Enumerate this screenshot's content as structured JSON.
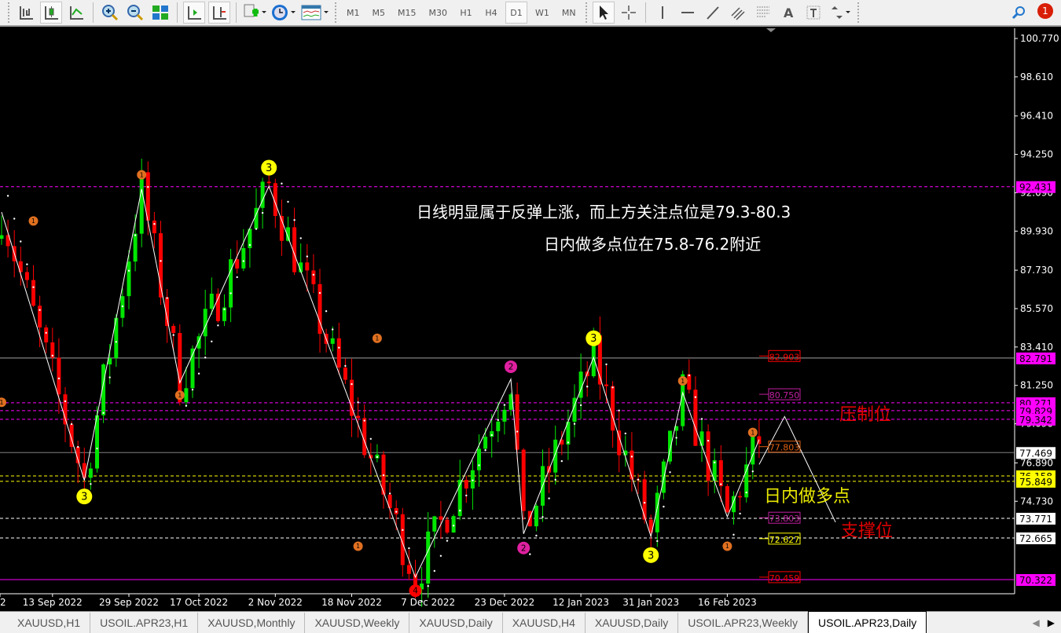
{
  "toolbar": {
    "timeframes": [
      "M1",
      "M5",
      "M15",
      "M30",
      "H1",
      "H4",
      "D1",
      "W1",
      "MN"
    ],
    "active_timeframe": "D1",
    "notification_count": "1"
  },
  "chart_data": {
    "type": "candlestick",
    "symbol": "USOIL.APR23",
    "period": "Daily",
    "ylim": [
      70.322,
      100.77
    ],
    "y_ticks": [
      "100.770",
      "98.610",
      "96.410",
      "94.250",
      "92.090",
      "89.930",
      "87.730",
      "85.570",
      "83.410",
      "81.250",
      "79.090",
      "76.890",
      "74.730"
    ],
    "x_ticks": [
      {
        "label": "2",
        "index": 0
      },
      {
        "label": "13 Sep 2022",
        "index": 8
      },
      {
        "label": "29 Sep 2022",
        "index": 20
      },
      {
        "label": "17 Oct 2022",
        "index": 31
      },
      {
        "label": "2 Nov 2022",
        "index": 43
      },
      {
        "label": "18 Nov 2022",
        "index": 55
      },
      {
        "label": "7 Dec 2022",
        "index": 67
      },
      {
        "label": "23 Dec 2022",
        "index": 79
      },
      {
        "label": "12 Jan 2023",
        "index": 91
      },
      {
        "label": "31 Jan 2023",
        "index": 102
      },
      {
        "label": "16 Feb 2023",
        "index": 114
      }
    ],
    "candle_count": 120,
    "zigzag_pivots": [
      {
        "i": 0,
        "p": 91.0
      },
      {
        "i": 13,
        "p": 75.9
      },
      {
        "i": 22,
        "p": 92.3
      },
      {
        "i": 28,
        "p": 81.4
      },
      {
        "i": 42,
        "p": 92.46
      },
      {
        "i": 65,
        "p": 70.46
      },
      {
        "i": 80,
        "p": 81.6
      },
      {
        "i": 82,
        "p": 72.9
      },
      {
        "i": 93,
        "p": 82.83
      },
      {
        "i": 102,
        "p": 72.75
      },
      {
        "i": 107,
        "p": 80.84
      },
      {
        "i": 114,
        "p": 73.86
      },
      {
        "i": 119,
        "p": 78.2
      }
    ],
    "projection": [
      {
        "i": 119,
        "p": 76.8
      },
      {
        "i": 123,
        "p": 79.5
      },
      {
        "i": 131,
        "p": 73.55
      }
    ],
    "levels": [
      {
        "price": 92.431,
        "label": "92.431",
        "color": "#ff00ff",
        "style": "dashed",
        "tag_bg": "#ff00ff",
        "tag_fg": "#000"
      },
      {
        "price": 82.791,
        "label": "82.791",
        "color": "#a0a0a0",
        "style": "solid",
        "tag_bg": "#ff00ff",
        "tag_fg": "#000"
      },
      {
        "price": 80.271,
        "label": "80.271",
        "color": "#ff00ff",
        "style": "dashed",
        "tag_bg": "#ff00ff",
        "tag_fg": "#000"
      },
      {
        "price": 79.829,
        "label": "79.829",
        "color": "#ff00ff",
        "style": "dashed",
        "tag_bg": "#ff00ff",
        "tag_fg": "#000"
      },
      {
        "price": 79.342,
        "label": "79.342",
        "color": "#ff00ff",
        "style": "dashed",
        "tag_bg": "#ff00ff",
        "tag_fg": "#000"
      },
      {
        "price": 77.469,
        "label": "77.469",
        "color": "#808080",
        "style": "solid",
        "tag_bg": "#ffffff",
        "tag_fg": "#000"
      },
      {
        "price": 76.158,
        "label": "76.158",
        "color": "#ffff00",
        "style": "dashed",
        "tag_bg": "#ffff00",
        "tag_fg": "#000"
      },
      {
        "price": 75.849,
        "label": "75.849",
        "color": "#ffff00",
        "style": "dashed",
        "tag_bg": "#ffff00",
        "tag_fg": "#000"
      },
      {
        "price": 73.771,
        "label": "73.771",
        "color": "#ffffff",
        "style": "dashed",
        "tag_bg": "#ffffff",
        "tag_fg": "#000"
      },
      {
        "price": 72.665,
        "label": "72.665",
        "color": "#ffffff",
        "style": "dashed",
        "tag_bg": "#ffffff",
        "tag_fg": "#000"
      },
      {
        "price": 70.322,
        "label": "70.322",
        "color": "#ff00ff",
        "style": "solid",
        "tag_bg": "#ff00ff",
        "tag_fg": "#000"
      }
    ],
    "price_boxes": [
      {
        "price": 82.903,
        "label": "82.903",
        "color": "#ff0000"
      },
      {
        "price": 80.75,
        "label": "80.750",
        "color": "#c020a0"
      },
      {
        "price": 77.803,
        "label": "77.803",
        "color": "#e06010"
      },
      {
        "price": 73.803,
        "label": "73.803",
        "color": "#c020a0"
      },
      {
        "price": 72.627,
        "label": "72.627",
        "color": "#ffff00"
      },
      {
        "price": 70.459,
        "label": "70.459",
        "color": "#ff0000"
      }
    ],
    "wave_labels": [
      {
        "i": 13,
        "p": 75.0,
        "text": "3",
        "color": "#ffff00",
        "size": "big"
      },
      {
        "i": 42,
        "p": 93.5,
        "text": "3",
        "color": "#ffff00",
        "size": "big"
      },
      {
        "i": 93,
        "p": 83.9,
        "text": "3",
        "color": "#ffff00",
        "size": "big"
      },
      {
        "i": 102,
        "p": 71.7,
        "text": "3",
        "color": "#ffff00",
        "size": "big"
      },
      {
        "i": 22,
        "p": 93.1,
        "text": "1",
        "color": "#e07020",
        "size": "small"
      },
      {
        "i": 5,
        "p": 90.5,
        "text": "1",
        "color": "#e07020",
        "size": "small"
      },
      {
        "i": 0,
        "p": 80.3,
        "text": "1",
        "color": "#e07020",
        "size": "small"
      },
      {
        "i": 28,
        "p": 80.7,
        "text": "1",
        "color": "#e07020",
        "size": "small"
      },
      {
        "i": 59,
        "p": 83.9,
        "text": "1",
        "color": "#e07020",
        "size": "small"
      },
      {
        "i": 56,
        "p": 72.2,
        "text": "1",
        "color": "#e07020",
        "size": "small"
      },
      {
        "i": 107,
        "p": 81.5,
        "text": "1",
        "color": "#e07020",
        "size": "small"
      },
      {
        "i": 114,
        "p": 72.2,
        "text": "1",
        "color": "#e07020",
        "size": "small"
      },
      {
        "i": 118,
        "p": 78.6,
        "text": "1",
        "color": "#e07020",
        "size": "small"
      },
      {
        "i": 80,
        "p": 82.3,
        "text": "2",
        "color": "#e020a0",
        "size": "mid"
      },
      {
        "i": 82,
        "p": 72.1,
        "text": "2",
        "color": "#e020a0",
        "size": "mid"
      },
      {
        "i": 65,
        "p": 69.7,
        "text": "4",
        "color": "#ff0000",
        "size": "mid"
      }
    ],
    "annotations": {
      "line1": "日线明显属于反弹上涨，而上方关注点位是79.3-80.3",
      "line2": "日内做多点位在75.8-76.2附近",
      "resistance": "压制位",
      "long_zone": "日内做多点",
      "support": "支撑位"
    }
  },
  "tabs": [
    {
      "label": "XAUUSD,H1"
    },
    {
      "label": "USOIL.APR23,H1"
    },
    {
      "label": "XAUUSD,Monthly"
    },
    {
      "label": "XAUUSD,Weekly"
    },
    {
      "label": "XAUUSD,Daily"
    },
    {
      "label": "XAUUSD,H4"
    },
    {
      "label": "XAUUSD,Daily"
    },
    {
      "label": "USOIL.APR23,Weekly"
    },
    {
      "label": "USOIL.APR23,Daily",
      "active": true
    }
  ],
  "colors": {
    "up": "#00e600",
    "down": "#ff0000",
    "background": "#000000",
    "axis": "#ffffff"
  }
}
